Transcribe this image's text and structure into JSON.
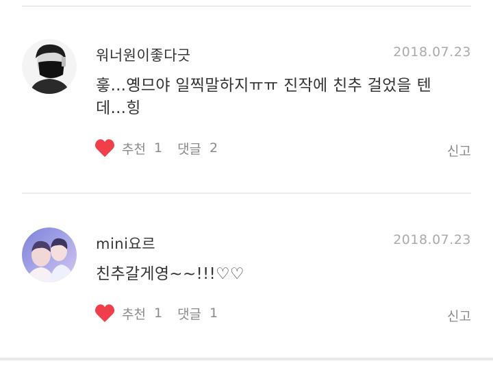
{
  "comments": [
    {
      "username": "워너원이좋다긋",
      "date": "2018.07.23",
      "text": "흫...옝므야 일찍말하지ㅠㅠ 진작에 친추 걸었을 텐데...힝",
      "like_label": "추천",
      "like_count": "1",
      "reply_label": "댓글",
      "reply_count": "2",
      "report_label": "신고"
    },
    {
      "username": "mini요르",
      "date": "2018.07.23",
      "text": "친추갈게영~~!!!♡♡",
      "like_label": "추천",
      "like_count": "1",
      "reply_label": "댓글",
      "reply_count": "1",
      "report_label": "신고"
    }
  ],
  "colors": {
    "heart": "#ee3f4a",
    "muted_text": "#8a8a8a",
    "date_text": "#aaaaaa",
    "divider": "#ebebeb"
  },
  "icons": {
    "like": "heart-icon"
  }
}
